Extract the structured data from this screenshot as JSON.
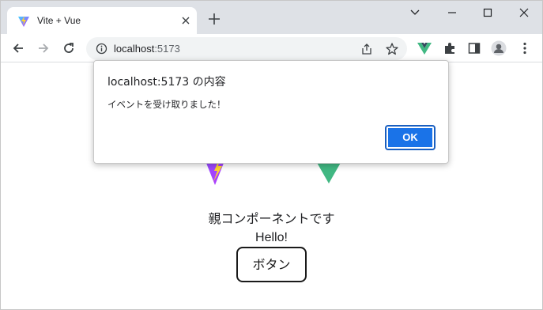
{
  "browser": {
    "tab_title": "Vite + Vue",
    "url_host": "localhost",
    "url_port": ":5173"
  },
  "page": {
    "parent_text": "親コンポーネントです",
    "hello_text": "Hello!",
    "button_label": "ボタン"
  },
  "alert": {
    "title": "localhost:5173 の内容",
    "message": "イベントを受け取りました！",
    "ok_label": "OK"
  },
  "icons": {
    "tab_favicon": "vite-logo-icon",
    "tab_close": "close-icon",
    "new_tab": "plus-icon",
    "window_controls": [
      "chevron-down-icon",
      "minimize-icon",
      "maximize-icon",
      "close-icon"
    ],
    "nav": [
      "back-arrow-icon",
      "forward-arrow-icon",
      "reload-icon"
    ],
    "omnibox": [
      "info-icon",
      "share-icon",
      "star-icon"
    ],
    "toolbar": [
      "vue-devtools-icon",
      "extensions-icon",
      "side-panel-icon",
      "profile-icon",
      "more-menu-icon"
    ],
    "page_logos": [
      "vite-logo",
      "vue-logo"
    ]
  },
  "colors": {
    "accent_blue": "#1a73e8",
    "vite_purple": "#bd34fe",
    "vite_yellow": "#ffd62e",
    "vue_green": "#41b883",
    "vue_dark": "#34495e"
  }
}
